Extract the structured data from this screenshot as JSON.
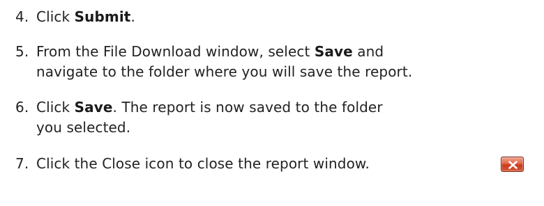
{
  "steps": [
    {
      "number": "4.",
      "before": "Click ",
      "bold": "Submit",
      "after": "."
    },
    {
      "number": "5.",
      "before": "From the File Download window, select ",
      "bold": "Save",
      "after": " and",
      "line2": "navigate to the folder where you will save the report."
    },
    {
      "number": "6.",
      "before": "Click ",
      "bold": "Save",
      "after": ". The report is now saved to the folder",
      "line2": "you selected."
    },
    {
      "number": "7.",
      "text": "Click the Close icon to close the report window."
    }
  ],
  "icons": {
    "close": "close-icon",
    "close_color": "#d9512c"
  }
}
